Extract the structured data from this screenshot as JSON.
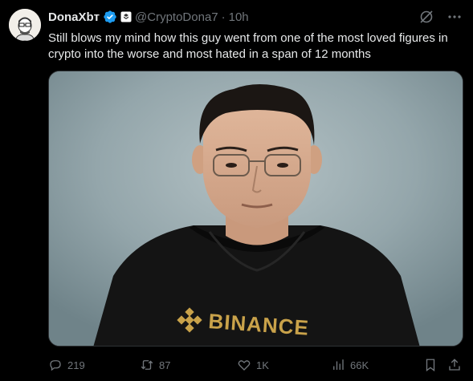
{
  "author": {
    "name": "DonaXbт",
    "handle": "@CryptoDona7",
    "separator": "·",
    "time": "10h"
  },
  "tweet": {
    "text": "Still blows my mind how this guy went from one of the most loved figures in crypto into the worse and most hated in a span of 12 months"
  },
  "media": {
    "hoodie_text": "BINANCE"
  },
  "actions": {
    "replies": "219",
    "reposts": "87",
    "likes": "1K",
    "views": "66K"
  },
  "icons": [
    "grok-icon",
    "more-icon",
    "reply-icon",
    "repost-icon",
    "like-icon",
    "views-icon",
    "bookmark-icon",
    "share-icon"
  ],
  "colors": {
    "background": "#000000",
    "text": "#e7e9ea",
    "muted": "#71767b",
    "verified": "#1d9bf0",
    "binance_gold": "#c9a24a"
  }
}
